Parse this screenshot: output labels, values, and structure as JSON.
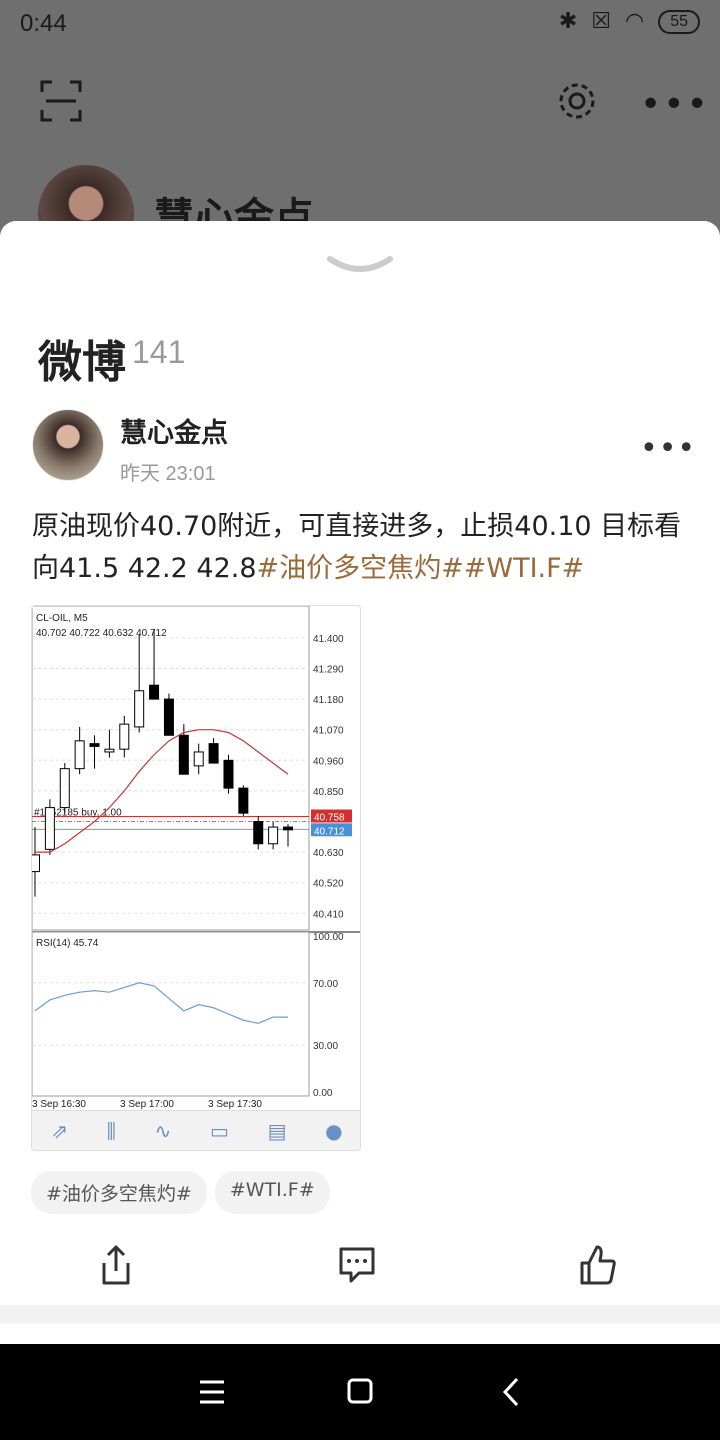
{
  "status": {
    "time": "0:44",
    "battery": "55",
    "icons": [
      "bluetooth-icon",
      "no-sim-icon",
      "wifi-icon",
      "battery-icon"
    ]
  },
  "profile": {
    "name": "慧心金点"
  },
  "sheet": {
    "section_title": "微博",
    "section_count": "141"
  },
  "post": {
    "author": "慧心金点",
    "time": "昨天 23:01",
    "text_plain": "原油现价40.70附近，可直接进多，止损40.10 目标看向41.5 42.2 42.8",
    "text_tags": "#油价多空焦灼##WTI.F#",
    "tags": [
      "#油价多空焦灼#",
      "#WTI.F#"
    ]
  },
  "chart_data": {
    "type": "candlestick",
    "symbol": "CL-OIL, M5",
    "ohlc_readout": "40.702 40.722 40.632 40.712",
    "order_line": "#1962185 buy, 1.00",
    "price_levels": [
      "41.400",
      "41.290",
      "41.180",
      "41.070",
      "40.960",
      "40.850",
      "40.630",
      "40.520",
      "40.410"
    ],
    "price_labels": {
      "red": "40.758",
      "blue": "40.712"
    },
    "rsi_label": "RSI(14) 45.74",
    "rsi_levels": [
      "100.00",
      "70.00",
      "30.00",
      "0.00"
    ],
    "x_labels": [
      "3 Sep 16:30",
      "3 Sep 17:00",
      "3 Sep 17:30"
    ],
    "candles": [
      {
        "o": 40.56,
        "h": 40.72,
        "l": 40.47,
        "c": 40.62
      },
      {
        "o": 40.64,
        "h": 40.82,
        "l": 40.62,
        "c": 40.79
      },
      {
        "o": 40.79,
        "h": 40.95,
        "l": 40.77,
        "c": 40.93
      },
      {
        "o": 40.93,
        "h": 41.08,
        "l": 40.91,
        "c": 41.03
      },
      {
        "o": 41.02,
        "h": 41.05,
        "l": 40.93,
        "c": 41.01
      },
      {
        "o": 40.99,
        "h": 41.07,
        "l": 40.97,
        "c": 41.0
      },
      {
        "o": 41.0,
        "h": 41.12,
        "l": 40.97,
        "c": 41.09
      },
      {
        "o": 41.08,
        "h": 41.41,
        "l": 41.06,
        "c": 41.21
      },
      {
        "o": 41.23,
        "h": 41.43,
        "l": 41.18,
        "c": 41.18
      },
      {
        "o": 41.18,
        "h": 41.2,
        "l": 41.06,
        "c": 41.05
      },
      {
        "o": 41.05,
        "h": 41.09,
        "l": 40.94,
        "c": 40.91
      },
      {
        "o": 40.94,
        "h": 41.02,
        "l": 40.91,
        "c": 40.99
      },
      {
        "o": 41.02,
        "h": 41.04,
        "l": 40.96,
        "c": 40.95
      },
      {
        "o": 40.96,
        "h": 40.98,
        "l": 40.84,
        "c": 40.86
      },
      {
        "o": 40.86,
        "h": 40.87,
        "l": 40.76,
        "c": 40.77
      },
      {
        "o": 40.74,
        "h": 40.76,
        "l": 40.64,
        "c": 40.66
      },
      {
        "o": 40.66,
        "h": 40.74,
        "l": 40.64,
        "c": 40.72
      },
      {
        "o": 40.72,
        "h": 40.73,
        "l": 40.65,
        "c": 40.71
      }
    ],
    "ma_values": [
      40.63,
      40.63,
      40.66,
      40.7,
      40.74,
      40.79,
      40.85,
      40.92,
      40.98,
      41.03,
      41.06,
      41.07,
      41.07,
      41.06,
      41.03,
      40.99,
      40.95,
      40.91
    ],
    "rsi_values": [
      52,
      59,
      62,
      64,
      65,
      64,
      67,
      70,
      68,
      60,
      52,
      56,
      54,
      50,
      46,
      44,
      48,
      48
    ],
    "ylim": [
      40.35,
      41.45
    ],
    "rsi_ylim": [
      0,
      100
    ]
  },
  "chart_toolbar": [
    "trend-icon",
    "candles-icon",
    "indicators-icon",
    "inbox-icon",
    "news-icon",
    "chat-icon"
  ],
  "colors": {
    "tag": "#9a6a3a",
    "ma": "#c0393b",
    "rsi": "#6a9fd4",
    "red_label": "#d32f2f",
    "blue_label": "#4a90d9"
  }
}
